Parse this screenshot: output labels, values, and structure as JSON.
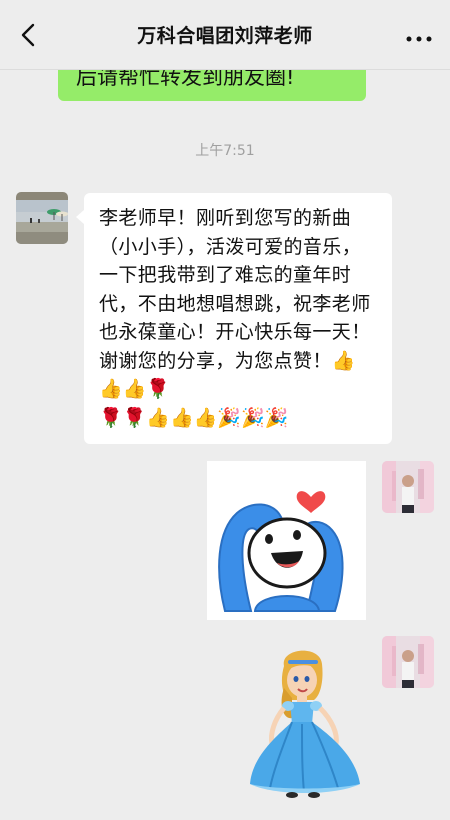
{
  "header": {
    "title": "万科合唱团刘萍老师",
    "back_icon": "chevron-left-icon",
    "more_icon": "more-dots-icon"
  },
  "messages": {
    "outgoing_text_partial": "后请帮忙转发到朋友圈!",
    "timestamp": "上午7:51",
    "incoming_text": "李老师早！刚听到您写的新曲（小小手），活泼可爱的音乐，一下把我带到了难忘的童年时代，不由地想唱想跳，祝李老师也永葆童心！开心快乐每一天！谢谢您的分享，为您点赞！",
    "incoming_emoji_line1": "👍👍👍🌹",
    "incoming_emoji_line2": "🌹🌹👍👍👍🎉🎉🎉",
    "sticker1": "heart-hands-sticker",
    "sticker2": "princess-doll-sticker"
  },
  "colors": {
    "background": "#ededed",
    "outgoing_bubble": "#95ec69",
    "incoming_bubble": "#ffffff",
    "sticker_blue": "#3b8ee8",
    "heart_red": "#f04a4a"
  }
}
